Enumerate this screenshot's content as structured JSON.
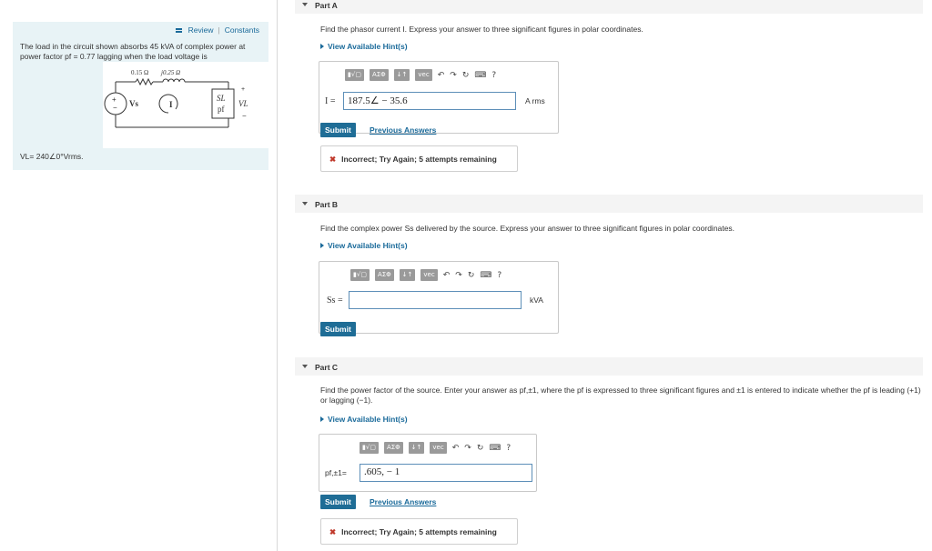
{
  "left": {
    "review": "Review",
    "constants": "Constants",
    "problem_text": "The load in the circuit shown absorbs 45 kVA of complex power at power factor pf = 0.77 lagging when the load voltage is",
    "vl_text": "VL= 240∠0°Vrms.",
    "circuit": {
      "r_label": "0.15 Ω",
      "x_label": "j0.25 Ω",
      "vs_label": "Vs",
      "i_label": "I",
      "sl_label": "SL",
      "pf_label": "pf",
      "vl_label": "VL",
      "plus": "+",
      "minus": "−"
    }
  },
  "toolbar": {
    "b1": "▮√▢",
    "b2": "AΣΦ",
    "b3": "↓↑",
    "b4": "vec",
    "undo": "↶",
    "redo": "↷",
    "reset": "↻",
    "keyboard": "⌨",
    "help": "?"
  },
  "partA": {
    "title": "Part A",
    "question": "Find the phasor current I. Express your answer to three significant figures in polar coordinates.",
    "hint": "View Available Hint(s)",
    "label": "I =",
    "value": "187.5∠ − 35.6",
    "unit": "A rms",
    "submit": "Submit",
    "previous": "Previous Answers",
    "feedback": "Incorrect; Try Again; 5 attempts remaining"
  },
  "partB": {
    "title": "Part B",
    "question": "Find the complex power Ss delivered by the source. Express your answer to three significant figures in polar coordinates.",
    "hint": "View Available Hint(s)",
    "label": "Ss =",
    "value": "",
    "unit": "kVA",
    "submit": "Submit"
  },
  "partC": {
    "title": "Part C",
    "question": "Find the power factor of the source. Enter your answer as pf,±1, where the pf is expressed to three significant figures and ±1 is entered to indicate whether the pf is leading (+1) or lagging (−1).",
    "hint": "View Available Hint(s)",
    "label": "pf,±1=",
    "value": ".605, − 1",
    "submit": "Submit",
    "previous": "Previous Answers",
    "feedback": "Incorrect; Try Again; 5 attempts remaining"
  }
}
